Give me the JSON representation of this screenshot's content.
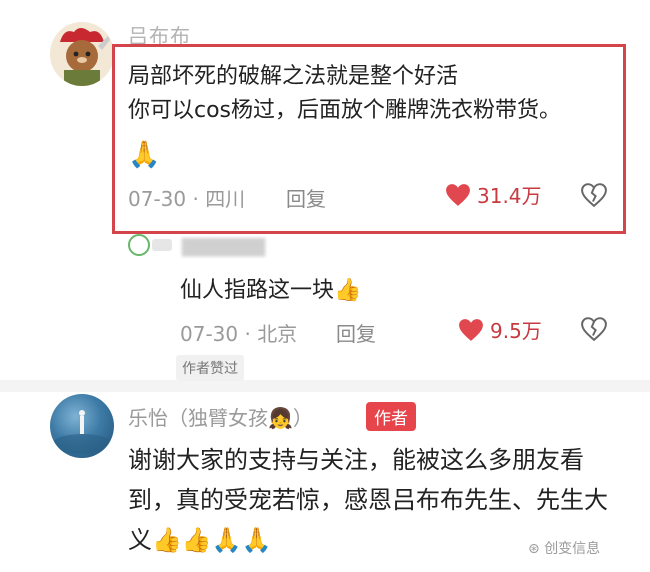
{
  "comments": [
    {
      "username": "吕布布",
      "text_lines": [
        "局部坏死的破解之法就是整个好活",
        "你可以cos杨过，后面放个雕牌洗衣粉带货。"
      ],
      "emoji": "🙏",
      "meta": "07-30 · 四川",
      "reply_label": "回复",
      "likes": "31.4万"
    },
    {
      "username": "乐怡（独臂女孩👧）",
      "author_tag": "作者",
      "text": "谢谢大家的支持与关注，能被这么多朋友看到，真的受宠若惊，感恩吕布布先生、先生大义👍👍🙏🙏"
    }
  ],
  "reply": {
    "username": "",
    "text": "仙人指路这一块👍",
    "meta": "07-30 · 北京",
    "reply_label": "回复",
    "likes": "9.5万",
    "liked_by_author": "作者赞过"
  },
  "watermark": "创变信息",
  "colors": {
    "accent": "#d3454b",
    "badge": "#e7454c"
  }
}
